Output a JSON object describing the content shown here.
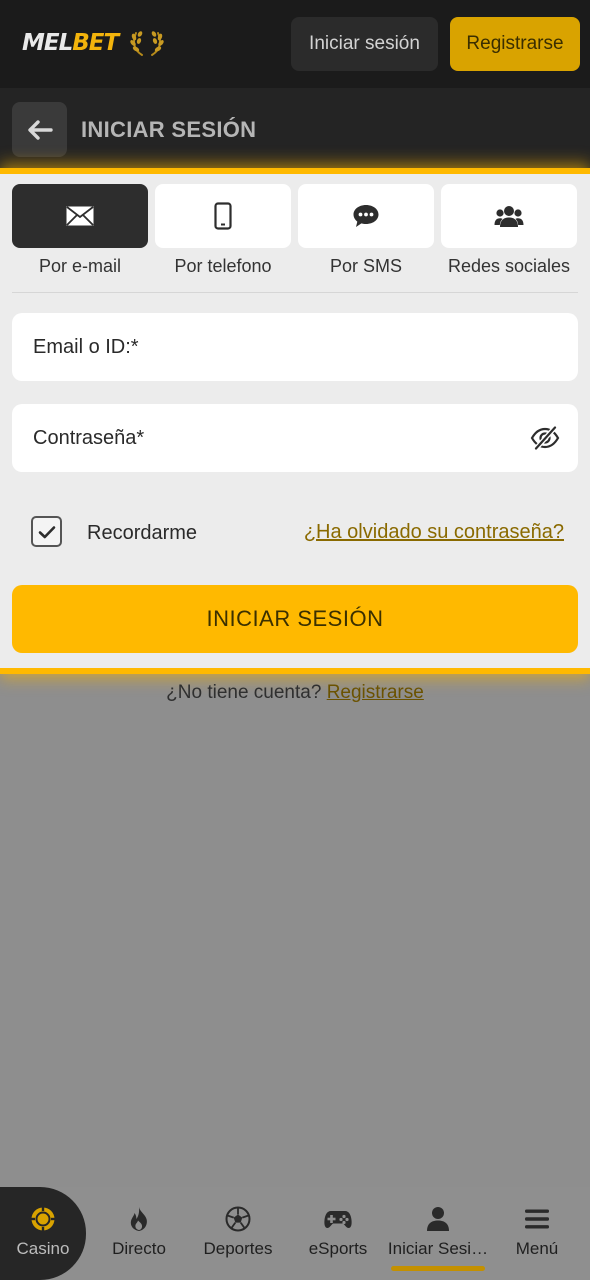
{
  "header": {
    "logo_mel": "MEL",
    "logo_bet": "BET",
    "login_label": "Iniciar sesión",
    "register_label": "Registrarse"
  },
  "subheader": {
    "title": "INICIAR SESIÓN"
  },
  "tabs": [
    {
      "label": "Por e-mail",
      "icon": "envelope-icon",
      "active": true
    },
    {
      "label": "Por telefono",
      "icon": "phone-icon",
      "active": false
    },
    {
      "label": "Por SMS",
      "icon": "sms-icon",
      "active": false
    },
    {
      "label": "Redes sociales",
      "icon": "users-icon",
      "active": false
    }
  ],
  "form": {
    "email_placeholder": "Email o ID:*",
    "password_placeholder": "Contraseña*",
    "remember_label": "Recordarme",
    "remember_checked": true,
    "forgot_label": "¿Ha olvidado su contraseña?",
    "submit_label": "INICIAR SESIÓN"
  },
  "footer_prompt": {
    "text": "¿No tiene cuenta?",
    "link": "Registrarse"
  },
  "bottom_nav": [
    {
      "label": "Casino",
      "icon": "casino-chip-icon"
    },
    {
      "label": "Directo",
      "icon": "flame-icon"
    },
    {
      "label": "Deportes",
      "icon": "soccer-ball-icon"
    },
    {
      "label": "eSports",
      "icon": "gamepad-icon"
    },
    {
      "label": "Iniciar Sesi…",
      "icon": "user-icon",
      "active": true
    },
    {
      "label": "Menú",
      "icon": "hamburger-icon"
    }
  ],
  "colors": {
    "accent": "#ffb900",
    "header_bg": "#1b1b1b",
    "overlay_bg": "#8e8e8e"
  }
}
